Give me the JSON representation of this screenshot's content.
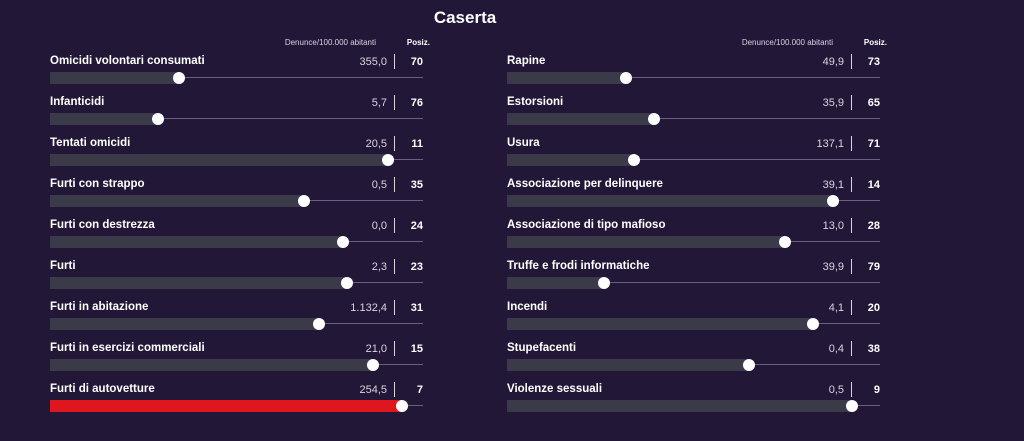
{
  "title": "Caserta",
  "header": {
    "unit": "Denunce/100.000 abitanti",
    "pos": "Posiz."
  },
  "colors": {
    "background": "#231737",
    "bar": "#3a3a49",
    "highlight": "#e0161f",
    "knob": "#ffffff"
  },
  "chart_data": {
    "type": "bar",
    "columns": [
      {
        "items": [
          {
            "label": "Omicidi volontari consumati",
            "value": "355,0",
            "rank": "70",
            "level": 0.345
          },
          {
            "label": "Infanticidi",
            "value": "5,7",
            "rank": "76",
            "level": 0.29
          },
          {
            "label": "Tentati omicidi",
            "value": "20,5",
            "rank": "11",
            "level": 0.905
          },
          {
            "label": "Furti con strappo",
            "value": "0,5",
            "rank": "35",
            "level": 0.68
          },
          {
            "label": "Furti con destrezza",
            "value": "0,0",
            "rank": "24",
            "level": 0.785
          },
          {
            "label": "Furti",
            "value": "2,3",
            "rank": "23",
            "level": 0.795
          },
          {
            "label": "Furti in abitazione",
            "value": "1.132,4",
            "rank": "31",
            "level": 0.72
          },
          {
            "label": "Furti in esercizi commerciali",
            "value": "21,0",
            "rank": "15",
            "level": 0.865
          },
          {
            "label": "Furti di autovetture",
            "value": "254,5",
            "rank": "7",
            "level": 0.945,
            "highlight": true
          }
        ]
      },
      {
        "items": [
          {
            "label": "Rapine",
            "value": "49,9",
            "rank": "73",
            "level": 0.32
          },
          {
            "label": "Estorsioni",
            "value": "35,9",
            "rank": "65",
            "level": 0.395
          },
          {
            "label": "Usura",
            "value": "137,1",
            "rank": "71",
            "level": 0.34
          },
          {
            "label": "Associazione per delinquere",
            "value": "39,1",
            "rank": "14",
            "level": 0.875
          },
          {
            "label": "Associazione di tipo mafioso",
            "value": "13,0",
            "rank": "28",
            "level": 0.745
          },
          {
            "label": "Truffe e frodi informatiche",
            "value": "39,9",
            "rank": "79",
            "level": 0.26
          },
          {
            "label": "Incendi",
            "value": "4,1",
            "rank": "20",
            "level": 0.82
          },
          {
            "label": "Stupefacenti",
            "value": "0,4",
            "rank": "38",
            "level": 0.65
          },
          {
            "label": "Violenze sessuali",
            "value": "0,5",
            "rank": "9",
            "level": 0.925
          }
        ]
      }
    ]
  }
}
